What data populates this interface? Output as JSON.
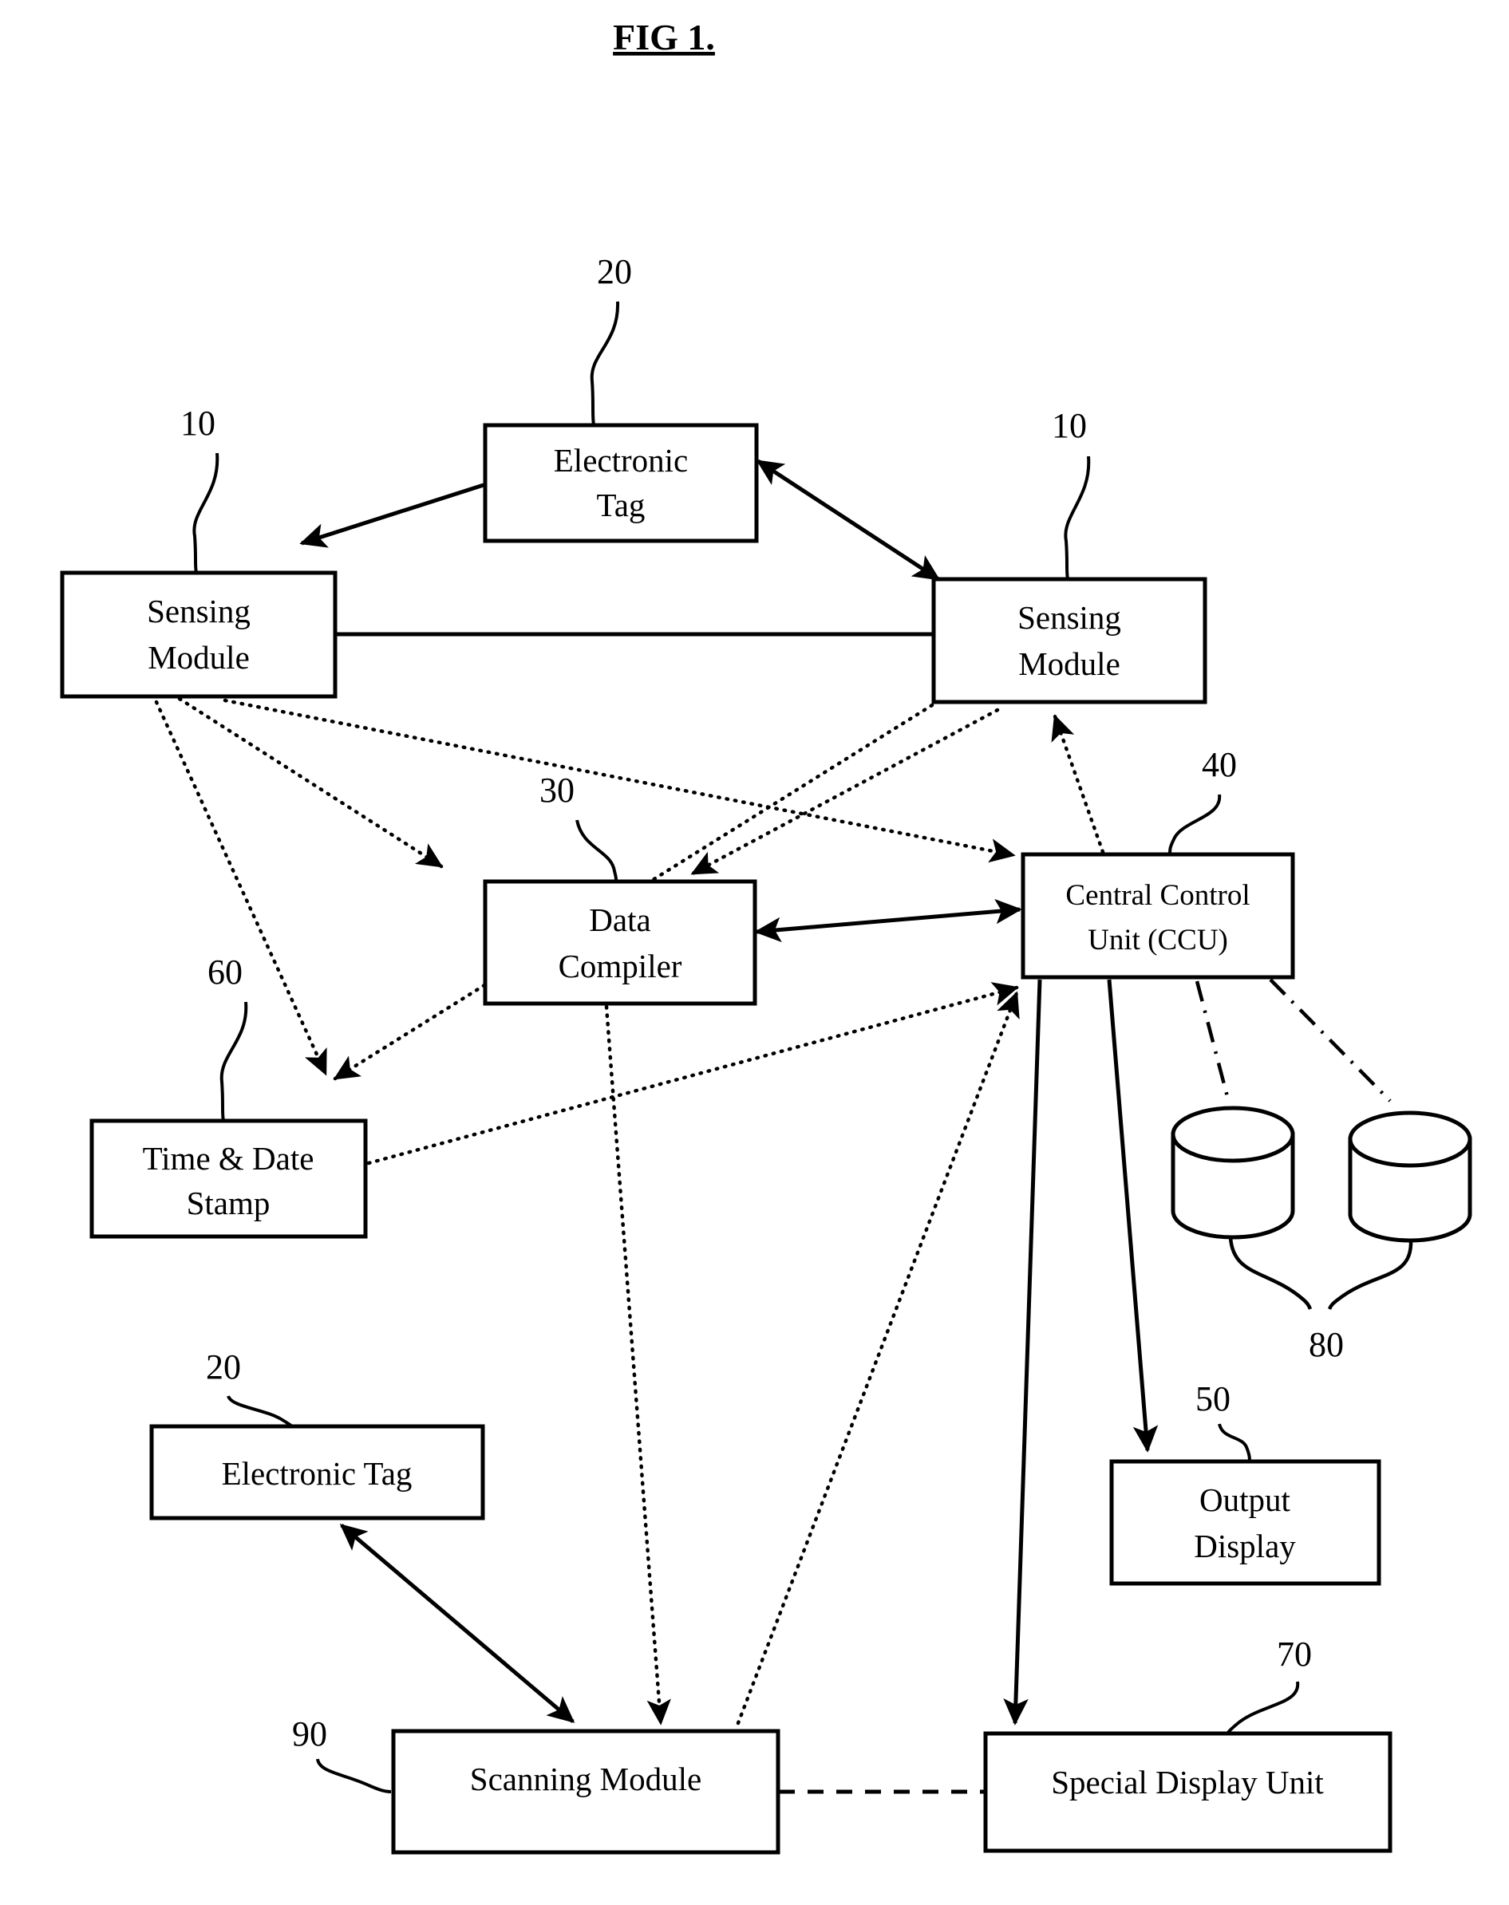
{
  "figure": {
    "title": "FIG 1."
  },
  "nodes": {
    "electronic_tag_top": {
      "label_line1": "Electronic",
      "label_line2": "Tag",
      "ref": "20"
    },
    "sensing_module_left": {
      "label_line1": "Sensing",
      "label_line2": "Module",
      "ref": "10"
    },
    "sensing_module_right": {
      "label_line1": "Sensing",
      "label_line2": "Module",
      "ref": "10"
    },
    "data_compiler": {
      "label_line1": "Data",
      "label_line2": "Compiler",
      "ref": "30"
    },
    "central_control_unit": {
      "label_line1": "Central Control",
      "label_line2": "Unit (CCU)",
      "ref": "40"
    },
    "time_date_stamp": {
      "label_line1": "Time & Date",
      "label_line2": "Stamp",
      "ref": "60"
    },
    "databases": {
      "ref": "80"
    },
    "output_display": {
      "label_line1": "Output",
      "label_line2": "Display",
      "ref": "50"
    },
    "electronic_tag_bottom": {
      "label": "Electronic Tag",
      "ref": "20"
    },
    "scanning_module": {
      "label": "Scanning Module",
      "ref": "90"
    },
    "special_display_unit": {
      "label": "Special Display Unit",
      "ref": "70"
    }
  },
  "colors": {
    "stroke": "#000000",
    "fill": "#ffffff",
    "background": "#ffffff"
  }
}
